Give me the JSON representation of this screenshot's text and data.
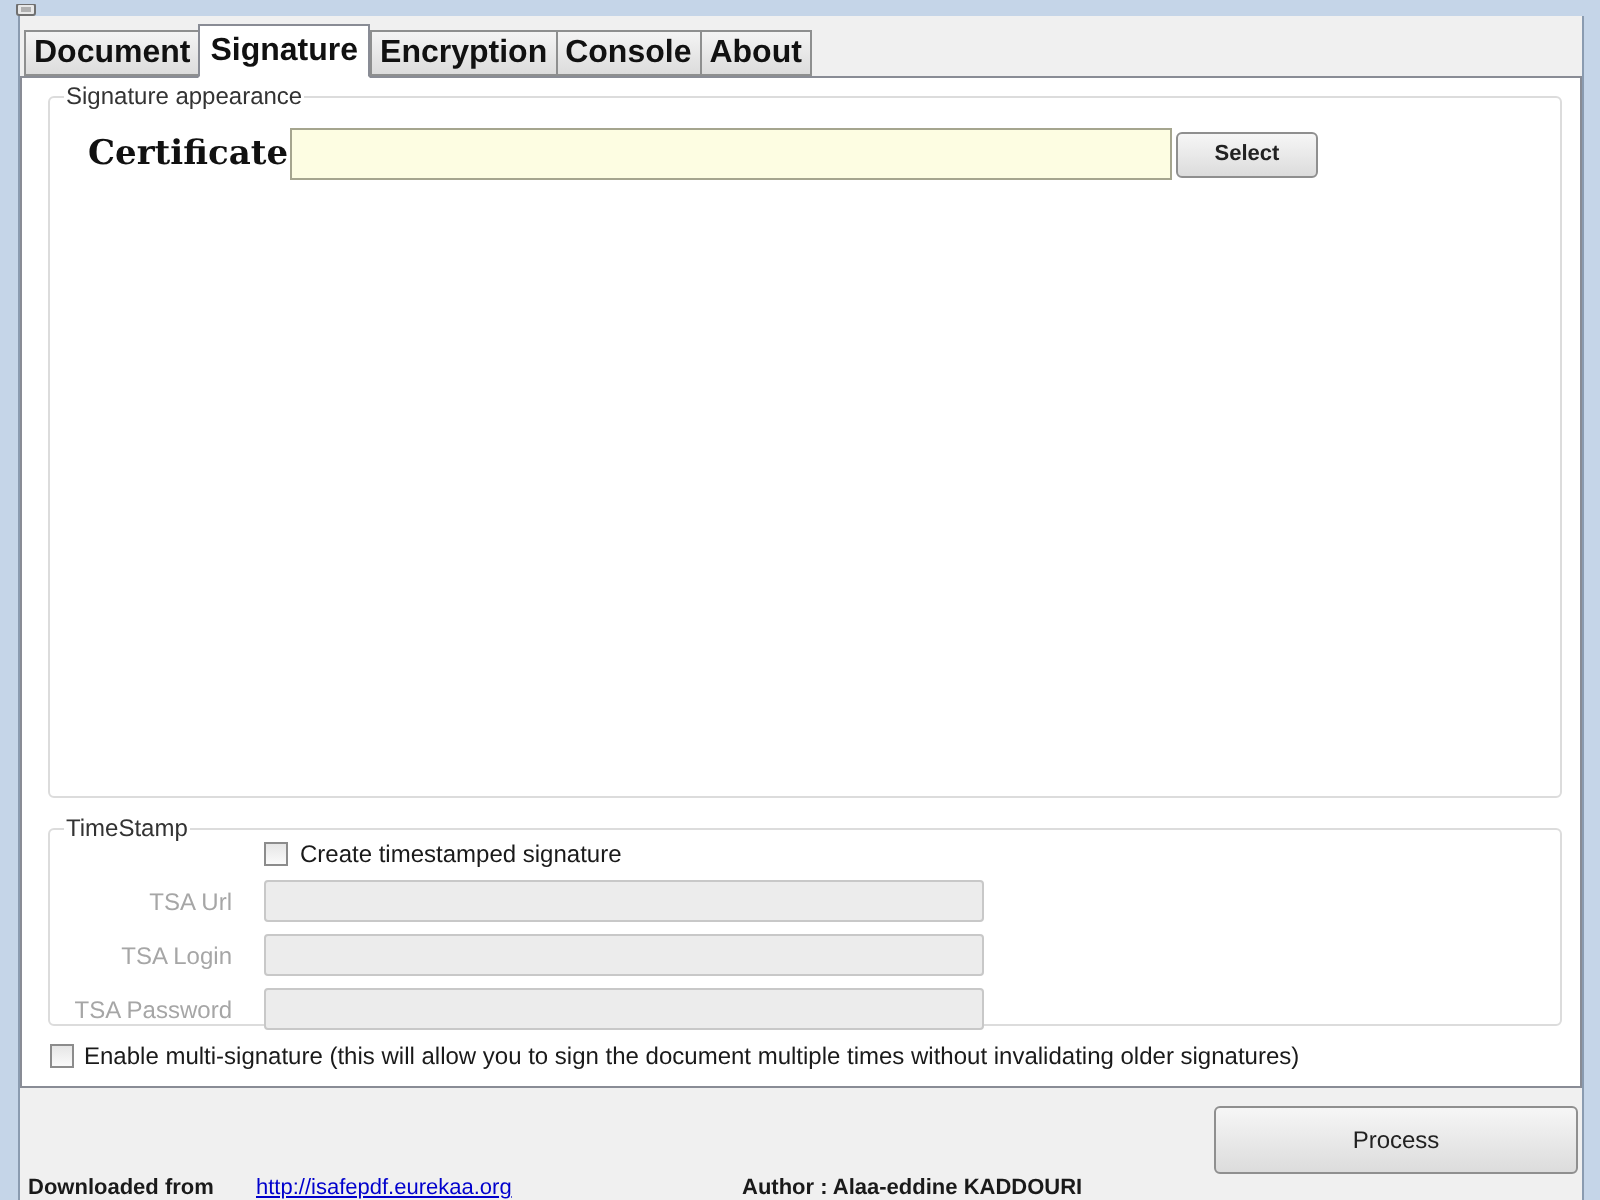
{
  "tabs": [
    {
      "label": "Document",
      "selected": false
    },
    {
      "label": "Signature",
      "selected": true
    },
    {
      "label": "Encryption",
      "selected": false
    },
    {
      "label": "Console",
      "selected": false
    },
    {
      "label": "About",
      "selected": false
    }
  ],
  "signature_appearance": {
    "title": "Signature appearance",
    "certificate_label": "Certificate",
    "select_button": "Select"
  },
  "timestamp": {
    "title": "TimeStamp",
    "create_checkbox": {
      "label": "Create timestamped signature",
      "checked": false
    },
    "fields": [
      {
        "label": "TSA Url",
        "disabled": true
      },
      {
        "label": "TSA Login",
        "disabled": true
      },
      {
        "label": "TSA Password",
        "disabled": true
      }
    ]
  },
  "multi_signature": {
    "label": "Enable multi-signature (this will allow you to sign the document multiple times without invalidating older signatures)",
    "checked": false
  },
  "process_button": "Process",
  "footer": {
    "downloaded_label": "Downloaded from",
    "link": "http://isafepdf.eurekaa.org",
    "author": "Author : Alaa-eddine KADDOURI"
  }
}
